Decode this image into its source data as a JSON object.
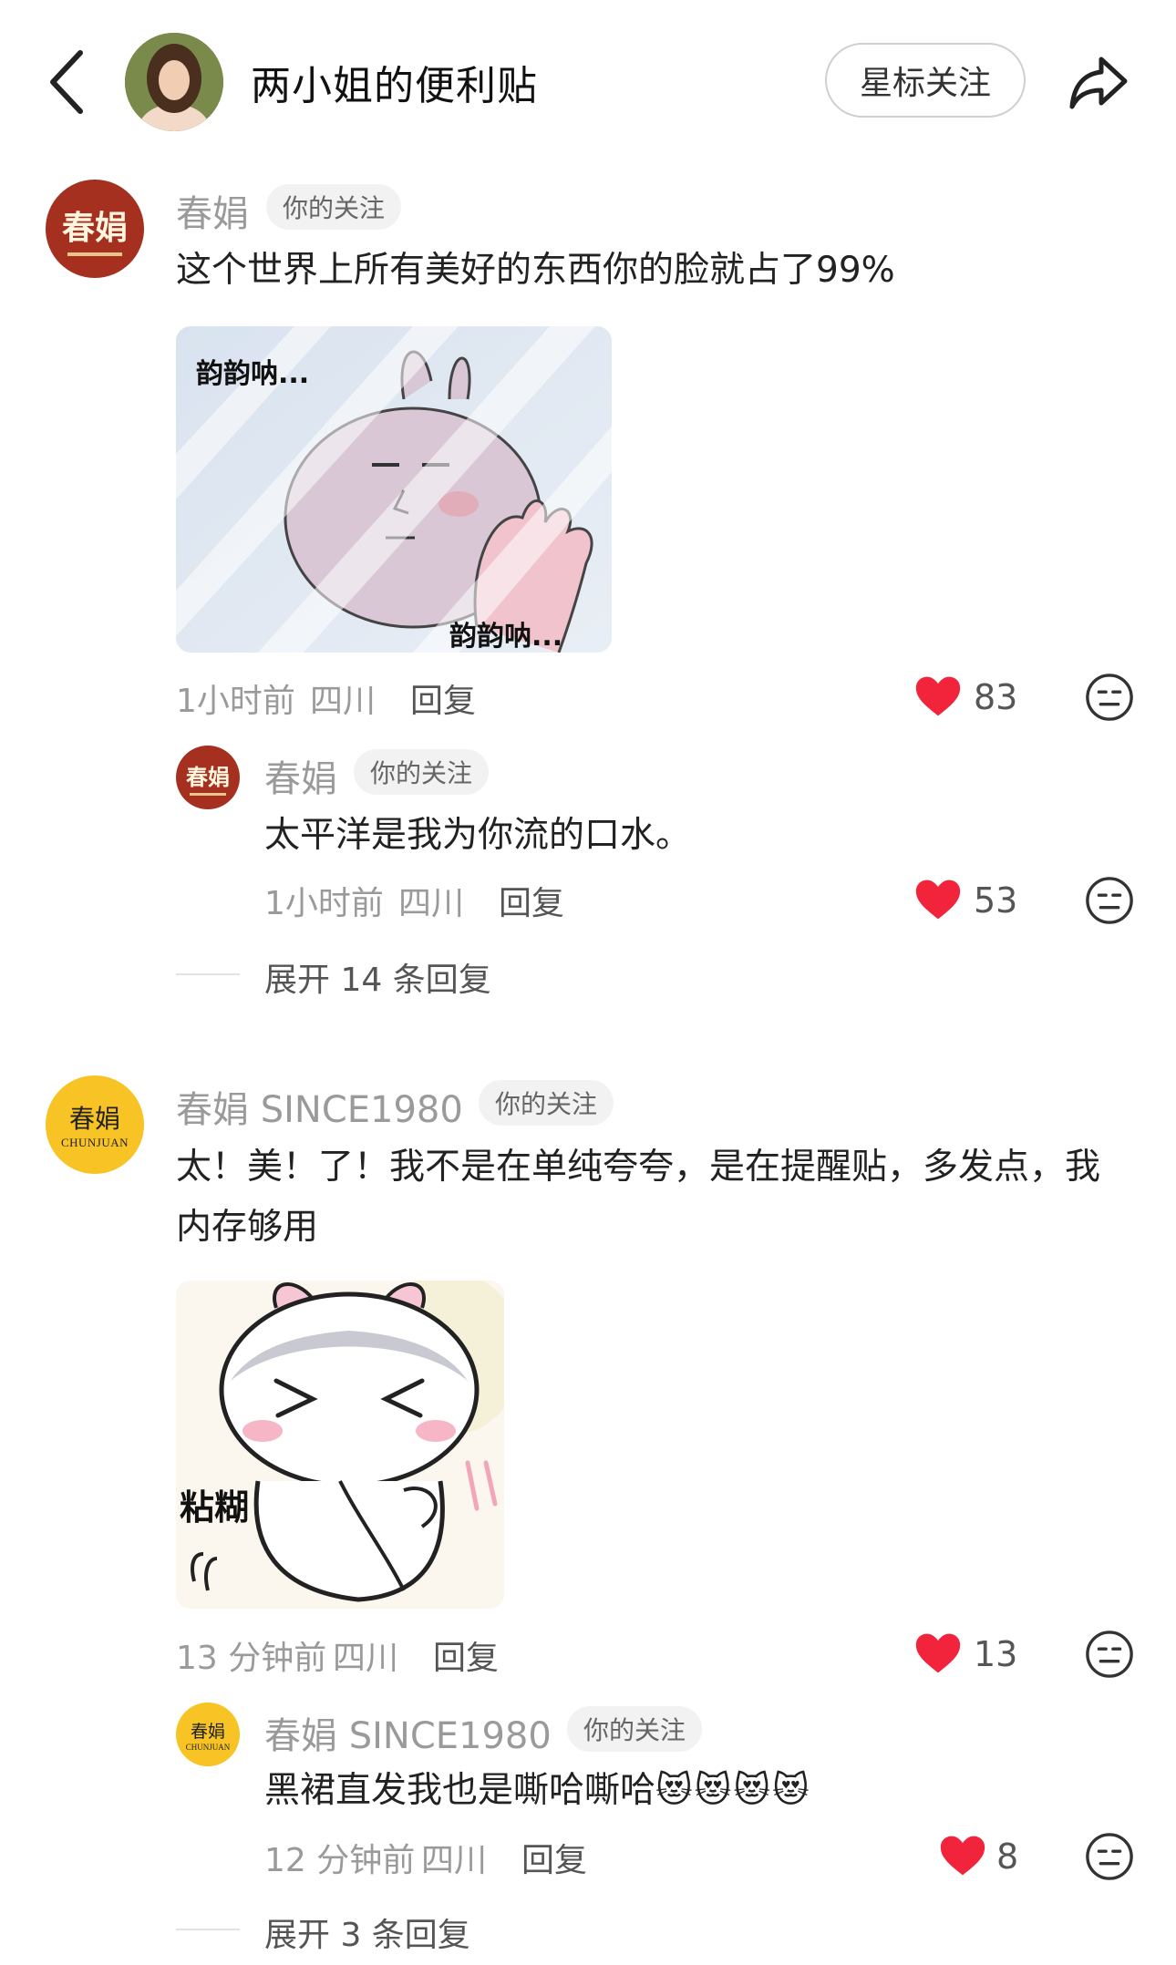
{
  "header": {
    "title": "两小姐的便利贴",
    "follow_label": "星标关注"
  },
  "colors": {
    "heart": "#f2243b",
    "brand_red": "#a6301f",
    "brand_yellow": "#f7c325"
  },
  "avatars": {
    "red_text": "春娟",
    "yellow_text": "春娟",
    "yellow_sub": "CHUNJUAN"
  },
  "comments": [
    {
      "author": "春娟",
      "tag": "你的关注",
      "text": "这个世界上所有美好的东西你的脸就占了99%",
      "sticker": {
        "top_text": "韵韵呐...",
        "bottom_text": "韵韵呐..."
      },
      "time": "1小时前",
      "location": "四川",
      "reply_label": "回复",
      "likes": "83",
      "replies": [
        {
          "author": "春娟",
          "tag": "你的关注",
          "text": "太平洋是我为你流的口水。",
          "time": "1小时前",
          "location": "四川",
          "reply_label": "回复",
          "likes": "53"
        }
      ],
      "expand_label": "展开 14 条回复"
    },
    {
      "author": "春娟 SINCE1980",
      "tag": "你的关注",
      "text": "太！美！了！我不是在单纯夸夸，是在提醒贴，多发点，我内存够用",
      "sticker": {
        "label": "粘糊"
      },
      "time": "13 分钟前",
      "location": "四川",
      "reply_label": "回复",
      "likes": "13",
      "replies": [
        {
          "author": "春娟 SINCE1980",
          "tag": "你的关注",
          "text": "黑裙直发我也是嘶哈嘶哈",
          "emoji": "😻😻😻😻",
          "time": "12 分钟前",
          "location": "四川",
          "reply_label": "回复",
          "likes": "8"
        }
      ],
      "expand_label": "展开 3 条回复"
    }
  ]
}
